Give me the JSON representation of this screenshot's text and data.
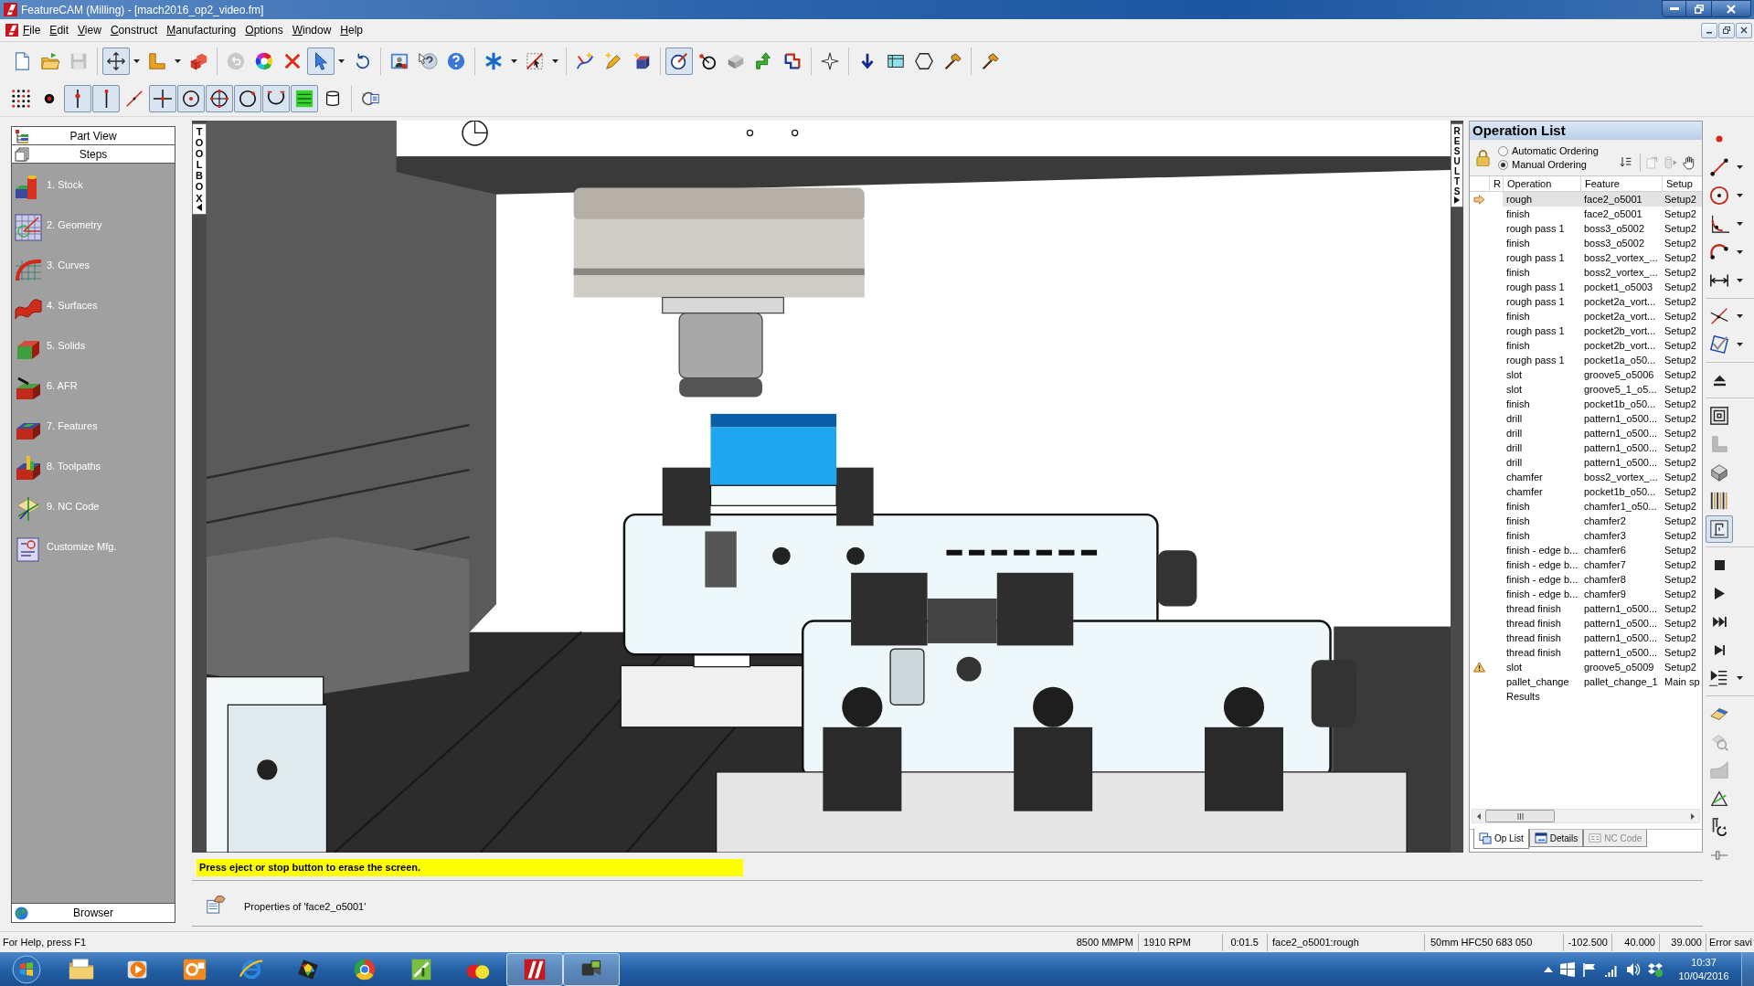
{
  "window": {
    "title": "FeatureCAM (Milling) - [mach2016_op2_video.fm]"
  },
  "menu": [
    "File",
    "Edit",
    "View",
    "Construct",
    "Manufacturing",
    "Options",
    "Window",
    "Help"
  ],
  "toolbars": [
    {
      "groups": [
        [
          {
            "pressed": false,
            "menu": false,
            "disabled": false
          },
          {
            "pressed": false,
            "menu": false,
            "disabled": false
          },
          {
            "pressed": false,
            "menu": false,
            "disabled": true
          }
        ],
        [
          {
            "pressed": true,
            "menu": true,
            "disabled": false
          },
          {
            "pressed": false,
            "menu": true,
            "disabled": false
          },
          {
            "pressed": false,
            "menu": false,
            "disabled": false
          }
        ],
        [
          {
            "pressed": false,
            "menu": false,
            "disabled": true
          },
          {
            "pressed": false,
            "menu": false,
            "disabled": false
          },
          {
            "pressed": false,
            "menu": false,
            "disabled": false
          },
          {
            "pressed": true,
            "menu": true,
            "disabled": false
          },
          {
            "pressed": false,
            "menu": false,
            "disabled": false
          }
        ],
        [
          {
            "pressed": false,
            "menu": false,
            "disabled": false
          },
          {
            "pressed": false,
            "menu": false,
            "disabled": false
          },
          {
            "pressed": false,
            "menu": false,
            "disabled": false
          }
        ],
        [
          {
            "pressed": false,
            "menu": true,
            "disabled": false
          },
          {
            "pressed": false,
            "menu": true,
            "disabled": false
          }
        ],
        [
          {
            "pressed": false,
            "menu": false,
            "disabled": false
          },
          {
            "pressed": false,
            "menu": false,
            "disabled": false
          },
          {
            "pressed": false,
            "menu": false,
            "disabled": false
          }
        ],
        [
          {
            "pressed": true,
            "menu": false,
            "disabled": false
          },
          {
            "pressed": false,
            "menu": false,
            "disabled": false
          },
          {
            "pressed": false,
            "menu": false,
            "disabled": false
          },
          {
            "pressed": false,
            "menu": false,
            "disabled": false
          },
          {
            "pressed": false,
            "menu": false,
            "disabled": false
          }
        ],
        [
          {
            "pressed": false,
            "menu": false,
            "disabled": false
          }
        ],
        [
          {
            "pressed": false,
            "menu": false,
            "disabled": false
          },
          {
            "pressed": false,
            "menu": false,
            "disabled": false
          },
          {
            "pressed": false,
            "menu": false,
            "disabled": false
          },
          {
            "pressed": false,
            "menu": false,
            "disabled": false
          }
        ],
        [
          {
            "pressed": false,
            "menu": false,
            "disabled": false
          }
        ]
      ]
    },
    {
      "groups": [
        [
          {
            "pressed": false,
            "menu": false,
            "disabled": false
          },
          {
            "pressed": false,
            "menu": false,
            "disabled": false
          },
          {
            "pressed": true,
            "menu": false,
            "disabled": false
          },
          {
            "pressed": true,
            "menu": false,
            "disabled": false
          },
          {
            "pressed": false,
            "menu": false,
            "disabled": false
          },
          {
            "pressed": true,
            "menu": false,
            "disabled": false
          },
          {
            "pressed": true,
            "menu": false,
            "disabled": false
          },
          {
            "pressed": true,
            "menu": false,
            "disabled": false
          },
          {
            "pressed": true,
            "menu": false,
            "disabled": false
          },
          {
            "pressed": true,
            "menu": false,
            "disabled": false
          },
          {
            "pressed": true,
            "menu": false,
            "disabled": false
          },
          {
            "pressed": false,
            "menu": false,
            "disabled": false
          }
        ],
        [
          {
            "pressed": false,
            "menu": false,
            "disabled": false
          }
        ]
      ]
    }
  ],
  "sidebar": {
    "tabs": [
      "Part View",
      "Steps"
    ],
    "steps": [
      "1. Stock",
      "2. Geometry",
      "3. Curves",
      "4. Surfaces",
      "5. Solids",
      "6. AFR",
      "7. Features",
      "8. Toolpaths",
      "9. NC Code",
      "Customize Mfg."
    ],
    "footer": "Browser"
  },
  "viewport": {
    "toolbox_tab": "TOOLBOX",
    "results_tab": "RESULTS"
  },
  "operation_list": {
    "title": "Operation List",
    "ordering": [
      {
        "label": "Automatic Ordering",
        "selected": false
      },
      {
        "label": "Manual Ordering",
        "selected": true
      }
    ],
    "tools": [
      {
        "disabled": false
      },
      {
        "disabled": true
      },
      {
        "disabled": true
      },
      {
        "disabled": false
      }
    ],
    "columns": [
      "R",
      "Operation",
      "Feature",
      "Setup"
    ],
    "rows": [
      {
        "operation": "rough",
        "feature": "face2_o5001",
        "setup": "Setup2",
        "selected": true,
        "current": true,
        "warning": false
      },
      {
        "operation": "finish",
        "feature": "face2_o5001",
        "setup": "Setup2",
        "selected": false,
        "current": false,
        "warning": false
      },
      {
        "operation": "rough pass 1",
        "feature": "boss3_o5002",
        "setup": "Setup2",
        "selected": false,
        "current": false,
        "warning": false
      },
      {
        "operation": "finish",
        "feature": "boss3_o5002",
        "setup": "Setup2",
        "selected": false,
        "current": false,
        "warning": false
      },
      {
        "operation": "rough pass 1",
        "feature": "boss2_vortex_...",
        "setup": "Setup2",
        "selected": false,
        "current": false,
        "warning": false
      },
      {
        "operation": "finish",
        "feature": "boss2_vortex_...",
        "setup": "Setup2",
        "selected": false,
        "current": false,
        "warning": false
      },
      {
        "operation": "rough pass 1",
        "feature": "pocket1_o5003",
        "setup": "Setup2",
        "selected": false,
        "current": false,
        "warning": false
      },
      {
        "operation": "rough pass 1",
        "feature": "pocket2a_vort...",
        "setup": "Setup2",
        "selected": false,
        "current": false,
        "warning": false
      },
      {
        "operation": "finish",
        "feature": "pocket2a_vort...",
        "setup": "Setup2",
        "selected": false,
        "current": false,
        "warning": false
      },
      {
        "operation": "rough pass 1",
        "feature": "pocket2b_vort...",
        "setup": "Setup2",
        "selected": false,
        "current": false,
        "warning": false
      },
      {
        "operation": "finish",
        "feature": "pocket2b_vort...",
        "setup": "Setup2",
        "selected": false,
        "current": false,
        "warning": false
      },
      {
        "operation": "rough pass 1",
        "feature": "pocket1a_o50...",
        "setup": "Setup2",
        "selected": false,
        "current": false,
        "warning": false
      },
      {
        "operation": "slot",
        "feature": "groove5_o5006",
        "setup": "Setup2",
        "selected": false,
        "current": false,
        "warning": false
      },
      {
        "operation": "slot",
        "feature": "groove5_1_o5...",
        "setup": "Setup2",
        "selected": false,
        "current": false,
        "warning": false
      },
      {
        "operation": "finish",
        "feature": "pocket1b_o50...",
        "setup": "Setup2",
        "selected": false,
        "current": false,
        "warning": false
      },
      {
        "operation": "drill",
        "feature": "pattern1_o500...",
        "setup": "Setup2",
        "selected": false,
        "current": false,
        "warning": false
      },
      {
        "operation": "drill",
        "feature": "pattern1_o500...",
        "setup": "Setup2",
        "selected": false,
        "current": false,
        "warning": false
      },
      {
        "operation": "drill",
        "feature": "pattern1_o500...",
        "setup": "Setup2",
        "selected": false,
        "current": false,
        "warning": false
      },
      {
        "operation": "drill",
        "feature": "pattern1_o500...",
        "setup": "Setup2",
        "selected": false,
        "current": false,
        "warning": false
      },
      {
        "operation": "chamfer",
        "feature": "boss2_vortex_...",
        "setup": "Setup2",
        "selected": false,
        "current": false,
        "warning": false
      },
      {
        "operation": "chamfer",
        "feature": "pocket1b_o50...",
        "setup": "Setup2",
        "selected": false,
        "current": false,
        "warning": false
      },
      {
        "operation": "finish",
        "feature": "chamfer1_o50...",
        "setup": "Setup2",
        "selected": false,
        "current": false,
        "warning": false
      },
      {
        "operation": "finish",
        "feature": "chamfer2",
        "setup": "Setup2",
        "selected": false,
        "current": false,
        "warning": false
      },
      {
        "operation": "finish",
        "feature": "chamfer3",
        "setup": "Setup2",
        "selected": false,
        "current": false,
        "warning": false
      },
      {
        "operation": "finish - edge b...",
        "feature": "chamfer6",
        "setup": "Setup2",
        "selected": false,
        "current": false,
        "warning": false
      },
      {
        "operation": "finish - edge b...",
        "feature": "chamfer7",
        "setup": "Setup2",
        "selected": false,
        "current": false,
        "warning": false
      },
      {
        "operation": "finish - edge b...",
        "feature": "chamfer8",
        "setup": "Setup2",
        "selected": false,
        "current": false,
        "warning": false
      },
      {
        "operation": "finish - edge b...",
        "feature": "chamfer9",
        "setup": "Setup2",
        "selected": false,
        "current": false,
        "warning": false
      },
      {
        "operation": "thread finish",
        "feature": "pattern1_o500...",
        "setup": "Setup2",
        "selected": false,
        "current": false,
        "warning": false
      },
      {
        "operation": "thread finish",
        "feature": "pattern1_o500...",
        "setup": "Setup2",
        "selected": false,
        "current": false,
        "warning": false
      },
      {
        "operation": "thread finish",
        "feature": "pattern1_o500...",
        "setup": "Setup2",
        "selected": false,
        "current": false,
        "warning": false
      },
      {
        "operation": "thread finish",
        "feature": "pattern1_o500...",
        "setup": "Setup2",
        "selected": false,
        "current": false,
        "warning": false
      },
      {
        "operation": "slot",
        "feature": "groove5_o5009",
        "setup": "Setup2",
        "selected": false,
        "current": false,
        "warning": true
      },
      {
        "operation": "pallet_change",
        "feature": "pallet_change_1",
        "setup": "Main sp",
        "selected": false,
        "current": false,
        "warning": false
      },
      {
        "operation": "Results",
        "selected": false,
        "current": false,
        "warning": false
      }
    ],
    "tabs": [
      {
        "label": "Op List",
        "selected": true,
        "disabled": false
      },
      {
        "label": "Details",
        "selected": false,
        "disabled": false
      },
      {
        "label": "NC Code",
        "selected": false,
        "disabled": true
      }
    ]
  },
  "side_toolbar": {
    "groups": [
      [
        {
          "pressed": false,
          "menu": false,
          "disabled": false
        },
        {
          "pressed": false,
          "menu": true,
          "disabled": false
        },
        {
          "pressed": false,
          "menu": true,
          "disabled": false
        },
        {
          "pressed": false,
          "menu": true,
          "disabled": false
        },
        {
          "pressed": false,
          "menu": true,
          "disabled": false
        },
        {
          "pressed": false,
          "menu": true,
          "disabled": false
        }
      ],
      [
        {
          "pressed": false,
          "menu": true,
          "disabled": false
        },
        {
          "pressed": false,
          "menu": true,
          "disabled": false
        }
      ],
      [
        {
          "pressed": false,
          "menu": false,
          "disabled": false
        }
      ],
      [
        {
          "pressed": false,
          "menu": false,
          "disabled": false
        },
        {
          "pressed": false,
          "menu": false,
          "disabled": true
        },
        {
          "pressed": false,
          "menu": false,
          "disabled": false
        },
        {
          "pressed": false,
          "menu": false,
          "disabled": false
        },
        {
          "pressed": true,
          "menu": false,
          "disabled": false
        }
      ],
      [
        {
          "pressed": false,
          "menu": false,
          "disabled": false
        },
        {
          "pressed": false,
          "menu": false,
          "disabled": false
        },
        {
          "pressed": false,
          "menu": false,
          "disabled": false
        },
        {
          "pressed": false,
          "menu": false,
          "disabled": false
        },
        {
          "pressed": false,
          "menu": true,
          "disabled": false
        }
      ],
      [
        {
          "pressed": false,
          "menu": false,
          "disabled": false
        },
        {
          "pressed": false,
          "menu": false,
          "disabled": true
        },
        {
          "pressed": false,
          "menu": false,
          "disabled": true
        },
        {
          "pressed": false,
          "menu": false,
          "disabled": false
        },
        {
          "pressed": false,
          "menu": false,
          "disabled": false
        },
        {
          "pressed": false,
          "menu": false,
          "disabled": false
        }
      ]
    ]
  },
  "message": "Press eject or stop button to erase the screen.",
  "properties": "Properties of 'face2_o5001'",
  "status_bar": {
    "help": "For Help, press F1",
    "fields": [
      "8500 MMPM",
      "1910 RPM",
      "0:01.5",
      "face2_o5001:rough",
      "50mm HFC50 683 050",
      "-102.500",
      "40.000",
      "39.000",
      "Error savi"
    ]
  },
  "taskbar": {
    "apps": [
      {
        "active": false
      },
      {
        "active": false
      },
      {
        "active": false
      },
      {
        "active": false
      },
      {
        "active": false
      },
      {
        "active": false
      },
      {
        "active": false
      },
      {
        "active": false
      },
      {
        "active": true
      },
      {
        "active": true
      }
    ],
    "time": "10:37",
    "date": "10/04/2016"
  }
}
